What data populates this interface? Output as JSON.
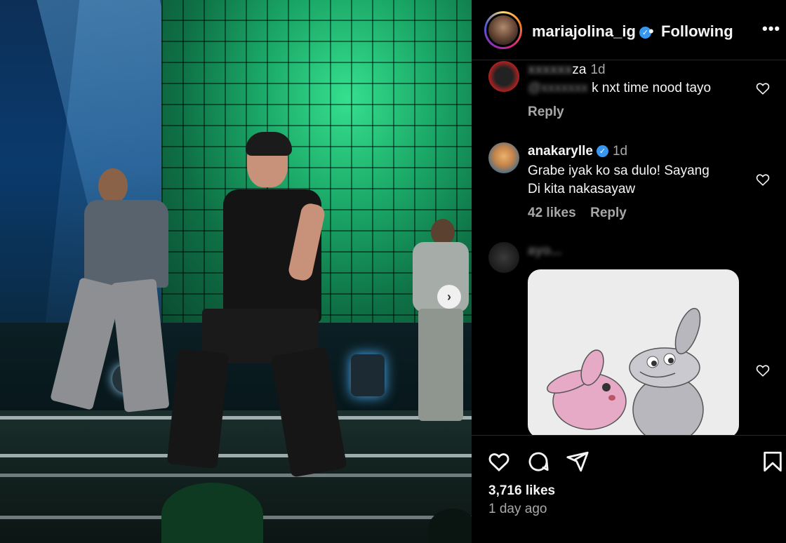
{
  "post": {
    "username": "mariajolina_ig",
    "separator": "•",
    "follow_state": "Following",
    "more_label": "•••"
  },
  "carousel": {
    "next_glyph": "›"
  },
  "comments": [
    {
      "username": "za",
      "time": "1d",
      "text": "k nxt time nood tayo",
      "reply_label": "Reply"
    },
    {
      "username": "anakarylle",
      "time": "1d",
      "text_line1": "Grabe iyak ko sa dulo! Sayang",
      "text_line2": "Di kita nakasayaw",
      "likes": "42 likes",
      "reply_label": "Reply"
    },
    {
      "username": "ayo...",
      "has_image": true
    }
  ],
  "footer": {
    "likes": "3,716 likes",
    "posted": "1 day ago"
  },
  "colors": {
    "verified": "#3897f0",
    "muted_text": "#a8a8a8",
    "background": "#000000"
  }
}
